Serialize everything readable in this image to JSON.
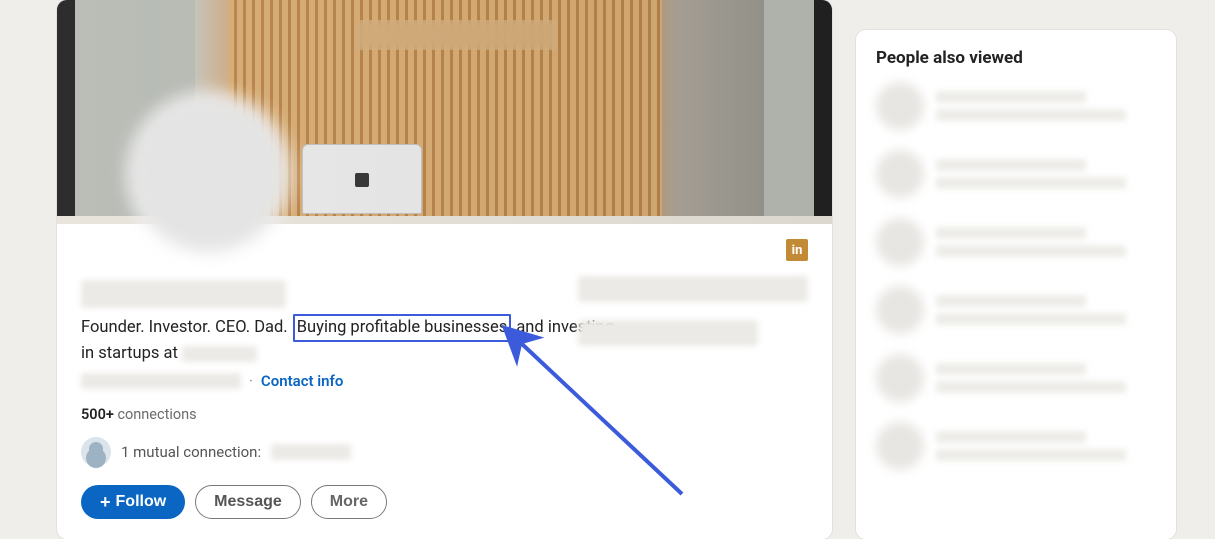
{
  "profile": {
    "headline_pre": "Founder. Investor. CEO. Dad.",
    "headline_highlight": "Buying profitable businesses",
    "headline_mid": "and investing in startups at",
    "contact_info_label": "Contact info",
    "connections_count": "500+",
    "connections_label": "connections",
    "mutual_label": "1 mutual connection:",
    "actions": {
      "follow": "Follow",
      "message": "Message",
      "more": "More"
    },
    "linkedin_badge": "in"
  },
  "sidebar": {
    "title": "People also viewed"
  }
}
